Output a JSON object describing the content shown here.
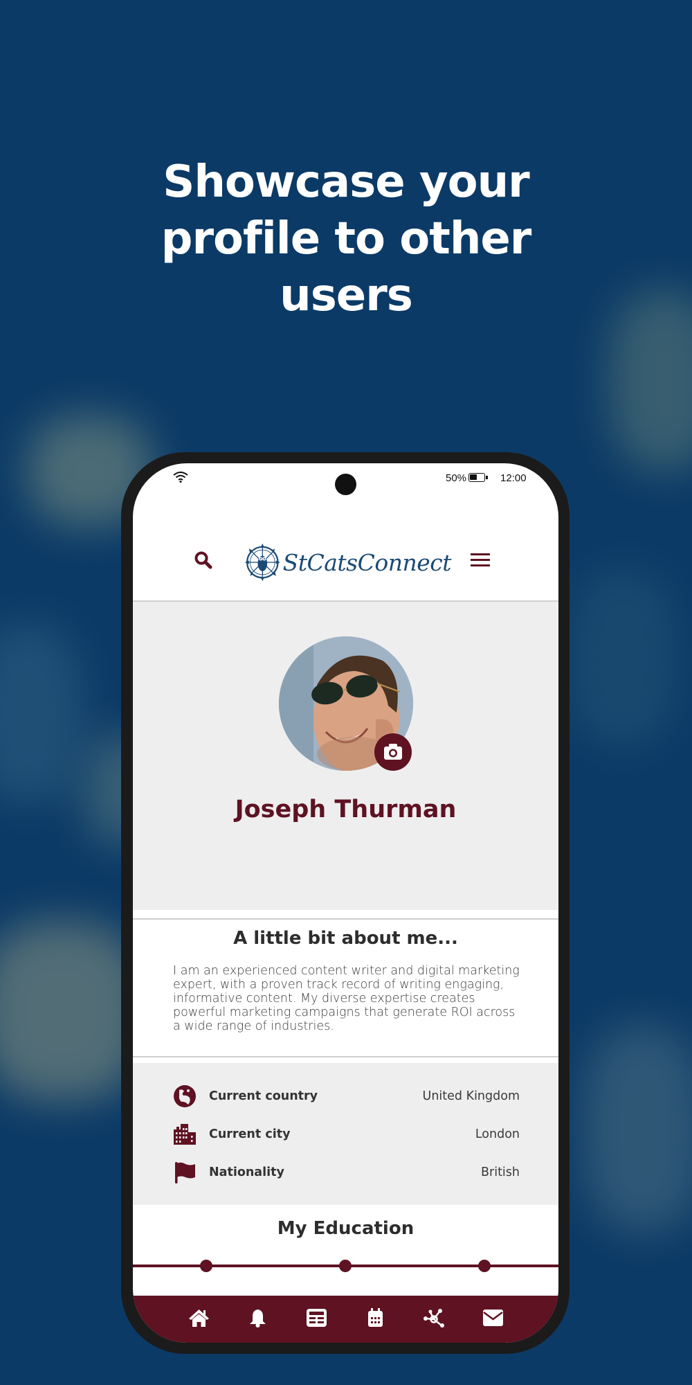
{
  "headline": {
    "line1": "Showcase your",
    "line2": "profile to other",
    "line3": "users"
  },
  "status_bar": {
    "battery_percent": "50%",
    "time": "12:00",
    "icons": [
      "wifi-icon",
      "battery-icon"
    ]
  },
  "app_bar": {
    "brand": "StCatsConnect",
    "search_icon": "search-icon",
    "menu_icon": "hamburger-menu-icon"
  },
  "profile": {
    "name": "Joseph Thurman",
    "avatar_alt": "Profile photo of Joseph Thurman",
    "camera_icon": "camera-icon"
  },
  "about": {
    "title": "A little bit about me...",
    "body": "I am an experienced content writer and digital marketing expert, with a proven track record of writing engaging, informative content. My diverse expertise creates powerful marketing campaigns that generate ROI across a wide range of industries."
  },
  "details": [
    {
      "icon": "globe-icon",
      "label": "Current country",
      "value": "United Kingdom"
    },
    {
      "icon": "city-icon",
      "label": "Current city",
      "value": "London"
    },
    {
      "icon": "flag-icon",
      "label": "Nationality",
      "value": "British"
    }
  ],
  "education": {
    "title": "My Education",
    "timeline_points": 3
  },
  "bottom_nav": [
    {
      "icon": "home-icon",
      "label": "Home"
    },
    {
      "icon": "bell-icon",
      "label": "Notifications"
    },
    {
      "icon": "news-icon",
      "label": "News"
    },
    {
      "icon": "calendar-icon",
      "label": "Events"
    },
    {
      "icon": "network-icon",
      "label": "Network"
    },
    {
      "icon": "envelope-icon",
      "label": "Messages"
    }
  ],
  "colors": {
    "background": "#0b3a66",
    "brand_maroon": "#5e1222",
    "brand_navy": "#1a4a75",
    "panel_gray": "#eeeeee"
  }
}
